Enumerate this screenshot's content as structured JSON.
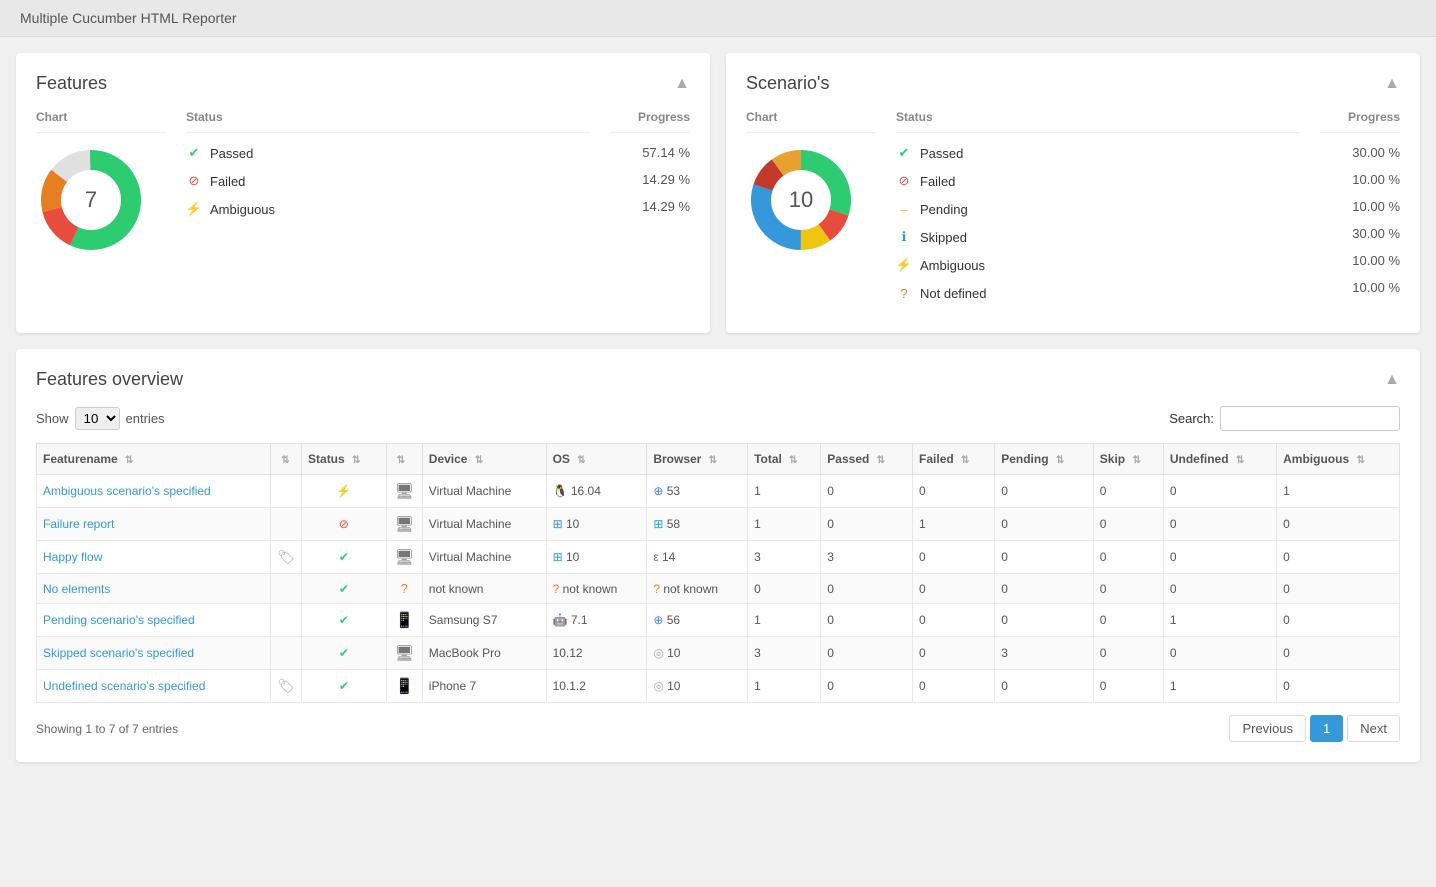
{
  "app": {
    "title": "Multiple Cucumber HTML Reporter"
  },
  "features_card": {
    "title": "Features",
    "collapse_label": "▲",
    "chart_center": "7",
    "columns": {
      "chart": "Chart",
      "status": "Status",
      "progress": "Progress"
    },
    "statuses": [
      {
        "id": "passed",
        "icon": "✔",
        "icon_class": "icon-passed",
        "label": "Passed",
        "pct": "57.14 %"
      },
      {
        "id": "failed",
        "icon": "🚫",
        "icon_class": "icon-failed",
        "label": "Failed",
        "pct": "14.29 %"
      },
      {
        "id": "ambiguous",
        "icon": "⚡",
        "icon_class": "icon-ambiguous",
        "label": "Ambiguous",
        "pct": "14.29 %"
      }
    ],
    "donut_segments": [
      {
        "color": "#2ecc71",
        "value": 57.14
      },
      {
        "color": "#e74c3c",
        "value": 14.29
      },
      {
        "color": "#e67e22",
        "value": 14.29
      },
      {
        "color": "#e0e0e0",
        "value": 14.29
      }
    ]
  },
  "scenarios_card": {
    "title": "Scenario's",
    "collapse_label": "▲",
    "chart_center": "10",
    "columns": {
      "chart": "Chart",
      "status": "Status",
      "progress": "Progress"
    },
    "statuses": [
      {
        "id": "passed",
        "icon": "✔",
        "icon_class": "icon-passed",
        "label": "Passed",
        "pct": "30.00 %"
      },
      {
        "id": "failed",
        "icon": "🚫",
        "icon_class": "icon-failed",
        "label": "Failed",
        "pct": "10.00 %"
      },
      {
        "id": "pending",
        "icon": "–",
        "icon_class": "icon-pending",
        "label": "Pending",
        "pct": "10.00 %"
      },
      {
        "id": "skipped",
        "icon": "ℹ",
        "icon_class": "icon-skipped",
        "label": "Skipped",
        "pct": "30.00 %"
      },
      {
        "id": "ambiguous",
        "icon": "⚡",
        "icon_class": "icon-ambiguous",
        "label": "Ambiguous",
        "pct": "10.00 %"
      },
      {
        "id": "notdefined",
        "icon": "?",
        "icon_class": "icon-notdefined",
        "label": "Not defined",
        "pct": "10.00 %"
      }
    ],
    "donut_segments": [
      {
        "color": "#2ecc71",
        "value": 30
      },
      {
        "color": "#e74c3c",
        "value": 10
      },
      {
        "color": "#f1c40f",
        "value": 10
      },
      {
        "color": "#3498db",
        "value": 30
      },
      {
        "color": "#e67e22",
        "value": 10
      },
      {
        "color": "#e8a030",
        "value": 10
      }
    ]
  },
  "overview": {
    "title": "Features overview",
    "collapse_label": "▲",
    "show_label": "Show",
    "entries_label": "entries",
    "search_label": "Search:",
    "search_placeholder": "",
    "show_value": "10",
    "columns": [
      {
        "id": "featurename",
        "label": "Featurename"
      },
      {
        "id": "tags",
        "label": ""
      },
      {
        "id": "status",
        "label": "Status"
      },
      {
        "id": "device_type",
        "label": ""
      },
      {
        "id": "device",
        "label": "Device"
      },
      {
        "id": "os",
        "label": "OS"
      },
      {
        "id": "browser",
        "label": "Browser"
      },
      {
        "id": "total",
        "label": "Total"
      },
      {
        "id": "passed",
        "label": "Passed"
      },
      {
        "id": "failed",
        "label": "Failed"
      },
      {
        "id": "pending",
        "label": "Pending"
      },
      {
        "id": "skip",
        "label": "Skip"
      },
      {
        "id": "undefined",
        "label": "Undefined"
      },
      {
        "id": "ambiguous",
        "label": "Ambiguous"
      }
    ],
    "rows": [
      {
        "featurename": "Ambiguous scenario's specified",
        "featurename_link": "#",
        "tags": "",
        "status": "ambiguous",
        "device_type": "desktop",
        "device": "Virtual Machine",
        "os": "16.04",
        "os_icon": "linux",
        "browser": "53",
        "browser_icon": "chrome",
        "total": "1",
        "passed": "0",
        "failed": "0",
        "pending": "0",
        "skip": "0",
        "undefined": "0",
        "ambiguous": "1"
      },
      {
        "featurename": "Failure report",
        "featurename_link": "#",
        "tags": "",
        "status": "failed",
        "device_type": "desktop",
        "device": "Virtual Machine",
        "os": "10",
        "os_icon": "windows",
        "browser": "58",
        "browser_icon": "ie",
        "total": "1",
        "passed": "0",
        "failed": "1",
        "pending": "0",
        "skip": "0",
        "undefined": "0",
        "ambiguous": "0"
      },
      {
        "featurename": "Happy flow",
        "featurename_link": "#",
        "tags": "tag",
        "status": "passed",
        "device_type": "desktop",
        "device": "Virtual Machine",
        "os": "10",
        "os_icon": "windows",
        "browser": "14",
        "browser_icon": "edge",
        "total": "3",
        "passed": "3",
        "failed": "0",
        "pending": "0",
        "skip": "0",
        "undefined": "0",
        "ambiguous": "0"
      },
      {
        "featurename": "No elements",
        "featurename_link": "#",
        "tags": "",
        "status": "passed",
        "device_type": "notknown",
        "device": "not known",
        "os": "not known",
        "os_icon": "notknown",
        "browser": "not known",
        "browser_icon": "notknown",
        "total": "0",
        "passed": "0",
        "failed": "0",
        "pending": "0",
        "skip": "0",
        "undefined": "0",
        "ambiguous": "0"
      },
      {
        "featurename": "Pending scenario's specified",
        "featurename_link": "#",
        "tags": "",
        "status": "passed",
        "device_type": "mobile",
        "device": "Samsung S7",
        "os": "7.1",
        "os_icon": "android",
        "browser": "56",
        "browser_icon": "chrome",
        "total": "1",
        "passed": "0",
        "failed": "0",
        "pending": "0",
        "skip": "0",
        "undefined": "1",
        "ambiguous": "0"
      },
      {
        "featurename": "Skipped scenario's specified",
        "featurename_link": "#",
        "tags": "",
        "status": "passed",
        "device_type": "desktop",
        "device": "MacBook Pro",
        "os": "10.12",
        "os_icon": "apple",
        "browser": "10",
        "browser_icon": "safari",
        "total": "3",
        "passed": "0",
        "failed": "0",
        "pending": "3",
        "skip": "0",
        "undefined": "0",
        "ambiguous": "0"
      },
      {
        "featurename": "Undefined scenario's specified",
        "featurename_link": "#",
        "tags": "tag",
        "status": "passed",
        "device_type": "mobile",
        "device": "iPhone 7",
        "os": "10.1.2",
        "os_icon": "apple",
        "browser": "10",
        "browser_icon": "safari",
        "total": "1",
        "passed": "0",
        "failed": "0",
        "pending": "0",
        "skip": "0",
        "undefined": "1",
        "ambiguous": "0"
      }
    ],
    "showing_text": "Showing 1 to 7 of 7 entries",
    "pagination": {
      "previous_label": "Previous",
      "next_label": "Next",
      "current_page": "1"
    }
  }
}
